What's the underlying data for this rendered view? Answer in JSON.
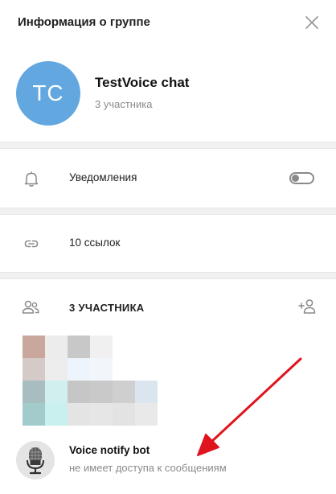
{
  "header": {
    "title": "Информация о группе",
    "close_icon": "close-icon"
  },
  "profile": {
    "avatar_initials": "TC",
    "avatar_color": "#62a7df",
    "name": "TestVoice chat",
    "members_count_text": "3 участника"
  },
  "notifications": {
    "icon": "bell-icon",
    "label": "Уведомления",
    "enabled": false
  },
  "links": {
    "icon": "link-icon",
    "label": "10 ссылок"
  },
  "members": {
    "icon": "people-icon",
    "label": "3 УЧАСТНИКА",
    "add_icon": "add-user-icon",
    "list": [
      {
        "name": "Voice notify bot",
        "status": "не имеет доступа к сообщениям",
        "avatar_icon": "microphone-icon"
      }
    ]
  },
  "annotation": {
    "arrow_color": "#e0141e"
  }
}
